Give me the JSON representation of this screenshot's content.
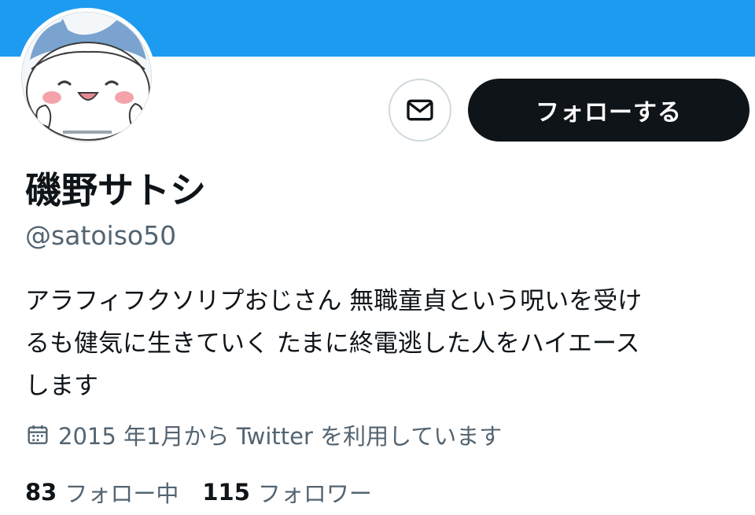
{
  "profile": {
    "name": "磯野サトシ",
    "handle": "@satoiso50",
    "bio_lines": [
      "アラフィフクソリプおじさん 無職童貞という呪いを受け",
      "るも健気に生きていく たまに終電逃した人をハイエース",
      "します"
    ],
    "joined": "2015 年1月から Twitter を利用しています",
    "following_count": "83",
    "following_label": "フォロー中",
    "followers_count": "115",
    "followers_label": "フォロワー"
  },
  "actions": {
    "follow_label": "フォローする",
    "message_icon": "envelope-icon"
  },
  "icons": {
    "joined": "calendar-icon"
  },
  "colors": {
    "banner": "#1d9bf0",
    "button_dark": "#0f1419",
    "secondary_text": "#536471"
  }
}
